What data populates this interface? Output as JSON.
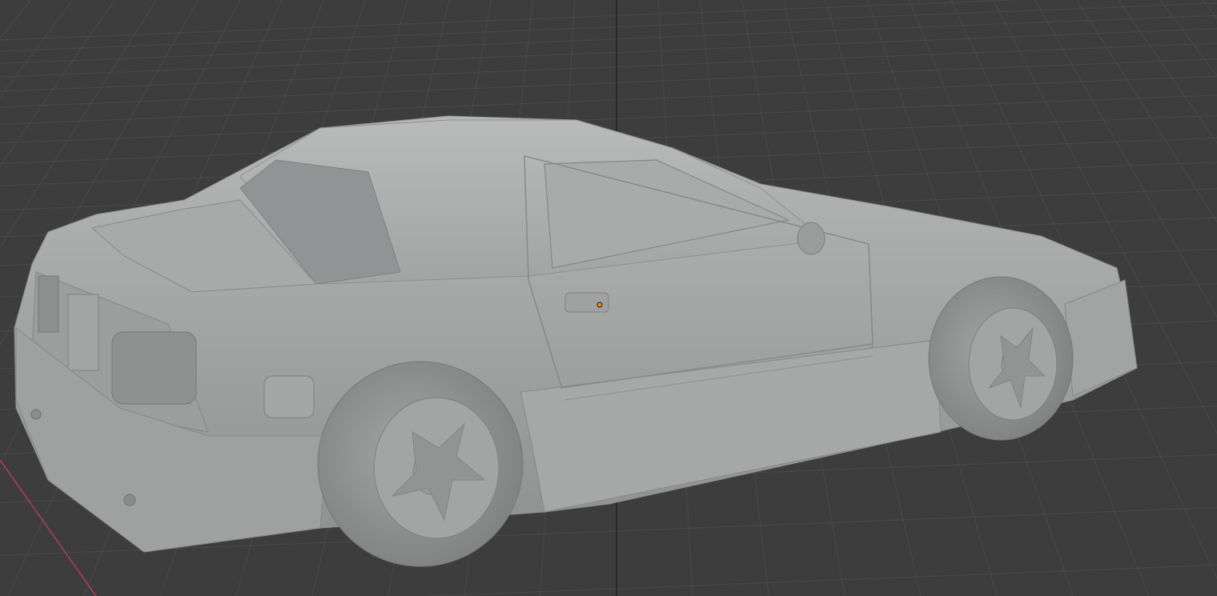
{
  "viewport": {
    "mode": "solid-shading",
    "background_color": "#3d3d3d",
    "grid_color": "#4a4a4a",
    "axis_x_color": "#b5414e",
    "axis_z_color": "#1a1a1a",
    "model_color": "#a7a9a8"
  },
  "model": {
    "icon": "car-model-icon",
    "object_origin": "origin-dot-icon",
    "origin_color": "#f08a1c"
  }
}
